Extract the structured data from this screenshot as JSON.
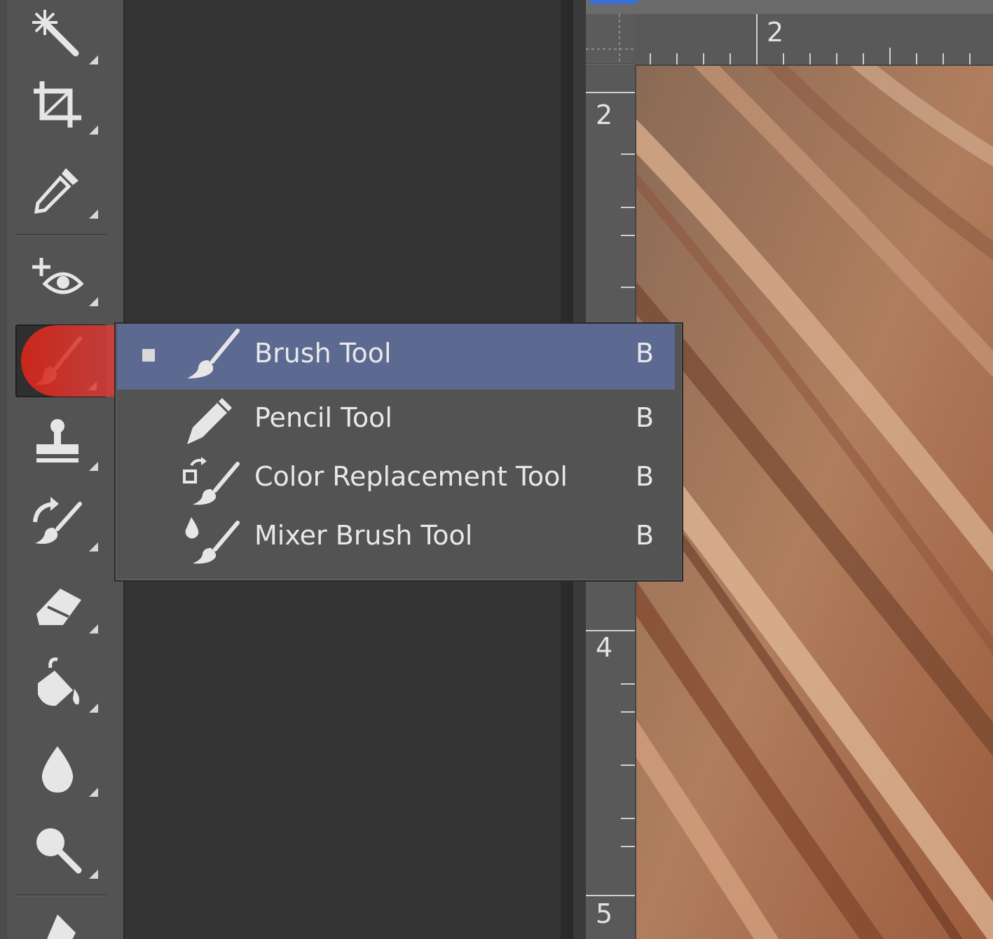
{
  "toolbar": {
    "tools": [
      {
        "name": "magic-wand-tool",
        "icon": "magic-wand-icon"
      },
      {
        "name": "crop-tool",
        "icon": "crop-icon"
      },
      {
        "name": "eyedropper-tool",
        "icon": "eyedropper-icon"
      },
      {
        "name": "red-eye-tool",
        "icon": "red-eye-icon"
      },
      {
        "name": "brush-tool",
        "icon": "brush-icon",
        "active": true
      },
      {
        "name": "clone-stamp-tool",
        "icon": "stamp-icon"
      },
      {
        "name": "history-brush-tool",
        "icon": "history-brush-icon"
      },
      {
        "name": "eraser-tool",
        "icon": "eraser-icon"
      },
      {
        "name": "paint-bucket-tool",
        "icon": "paint-bucket-icon"
      },
      {
        "name": "blur-tool",
        "icon": "drop-icon"
      },
      {
        "name": "dodge-tool",
        "icon": "dodge-icon"
      },
      {
        "name": "pen-tool",
        "icon": "pen-icon"
      }
    ]
  },
  "rulers": {
    "horizontal_labels": [
      "2"
    ],
    "vertical_labels": [
      "2",
      "4",
      "5"
    ]
  },
  "flyout": {
    "items": [
      {
        "label": "Brush Tool",
        "shortcut": "B",
        "icon": "brush-icon",
        "selected": true
      },
      {
        "label": "Pencil Tool",
        "shortcut": "B",
        "icon": "pencil-icon"
      },
      {
        "label": "Color Replacement Tool",
        "shortcut": "B",
        "icon": "color-replacement-icon"
      },
      {
        "label": "Mixer Brush Tool",
        "shortcut": "B",
        "icon": "mixer-brush-icon"
      }
    ]
  },
  "colors": {
    "menu_selection": "#5c6a92",
    "click_highlight": "#d92a1c",
    "canvas_tone": "#a27457"
  }
}
